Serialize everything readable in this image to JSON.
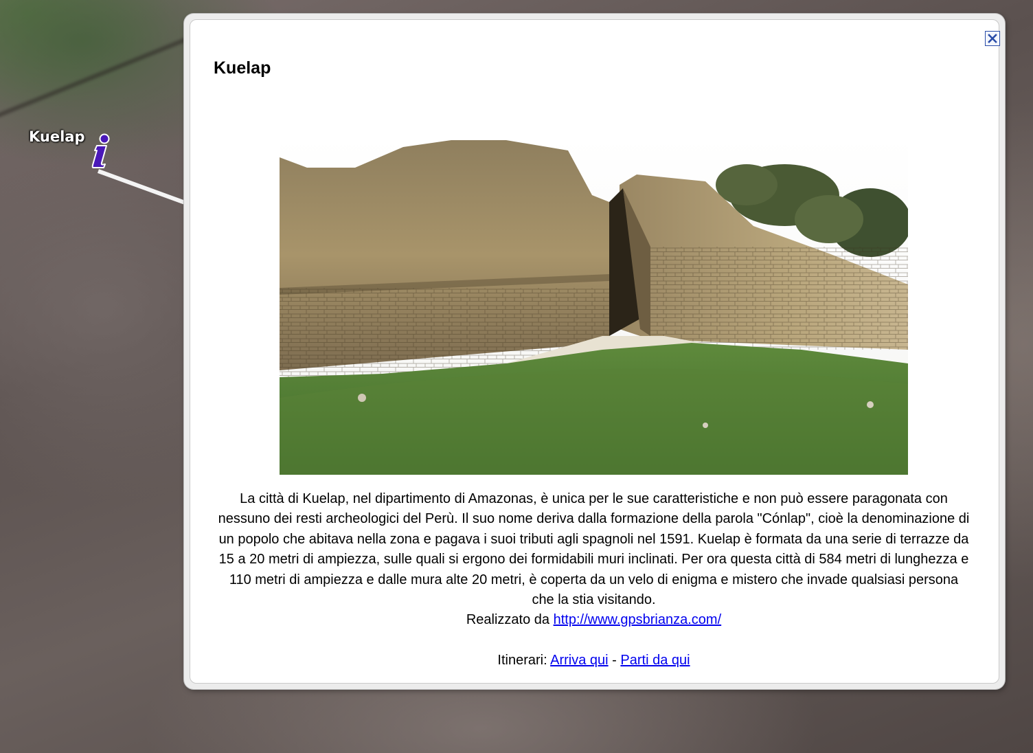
{
  "map": {
    "placemark_label": "Kuelap",
    "placemark_icon": "info-icon"
  },
  "balloon": {
    "title": "Kuelap",
    "close_icon": "close-icon",
    "description": "La città di Kuelap, nel dipartimento di Amazonas, è unica per le sue caratteristiche e non può essere paragonata con nessuno dei resti archeologici del Perù. Il suo nome deriva dalla formazione della parola \"Cónlap\", cioè la denominazione di un popolo che abitava nella zona e pagava i suoi tributi agli spagnoli nel 1591. Kuelap è formata da una serie di terrazze da 15 a 20 metri di ampiezza, sulle quali si ergono dei formidabili muri inclinati. Per ora questa città di 584 metri di lunghezza e 110 metri di ampiezza e dalle mura alte 20 metri, è coperta da un velo di enigma e mistero che invade qualsiasi persona che la stia visitando.",
    "credit_prefix": "Realizzato da",
    "credit_link": "http://www.gpsbrianza.com/",
    "itinerary_label": "Itinerari:",
    "arrive_link": "Arriva qui",
    "separator": "-",
    "depart_link": "Parti da qui"
  },
  "colors": {
    "link": "#0000ee",
    "pin": "#4a18b8",
    "close_border": "#2a4da8"
  }
}
